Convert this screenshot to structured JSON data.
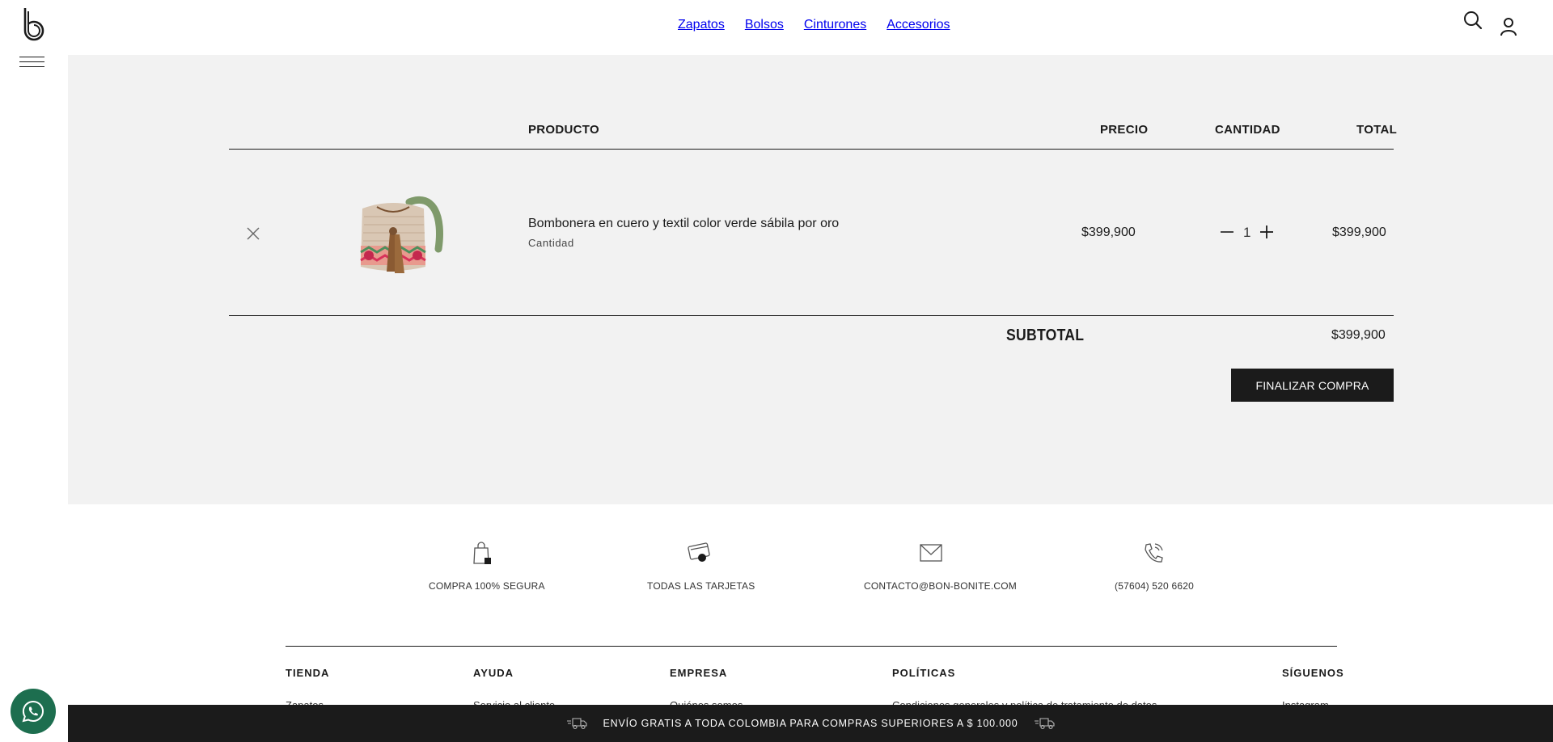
{
  "nav": {
    "items": [
      "Zapatos",
      "Bolsos",
      "Cinturones",
      "Accesorios"
    ]
  },
  "cart": {
    "headers": {
      "product": "PRODUCTO",
      "price": "PRECIO",
      "quantity": "CANTIDAD",
      "total": "TOTAL"
    },
    "item": {
      "name": "Bombonera en cuero y textil color verde sábila por oro",
      "sub_label": "Cantidad",
      "price": "$399,900",
      "quantity": "1",
      "total": "$399,900"
    },
    "subtotal_label": "SUBTOTAL",
    "subtotal_value": "$399,900",
    "checkout_label": "FINALIZAR COMPRA"
  },
  "features": [
    {
      "label": "COMPRA 100% SEGURA",
      "icon": "secure-bag-icon"
    },
    {
      "label": "TODAS LAS TARJETAS",
      "icon": "card-icon"
    },
    {
      "label": "CONTACTO@BON-BONITE.COM",
      "icon": "mail-icon"
    },
    {
      "label": "(57604) 520 6620",
      "icon": "phone-icon"
    }
  ],
  "footer": {
    "columns": [
      {
        "heading": "TIENDA",
        "first_link": "Zapatos"
      },
      {
        "heading": "AYUDA",
        "first_link": "Servicio al cliente"
      },
      {
        "heading": "EMPRESA",
        "first_link": "Quiénes somos"
      },
      {
        "heading": "POLÍTICAS",
        "first_link": "Condiciones generales y política de tratamiento de datos"
      },
      {
        "heading": "SÍGUENOS",
        "first_link": "Instagram"
      }
    ]
  },
  "promo": {
    "text": "ENVÍO GRATIS A TODA COLOMBIA PARA COMPRAS SUPERIORES A $ 100.000"
  },
  "colors": {
    "dark": "#1b1b1b",
    "panel": "#f2f2f2",
    "whatsapp": "#1d6e4f"
  }
}
